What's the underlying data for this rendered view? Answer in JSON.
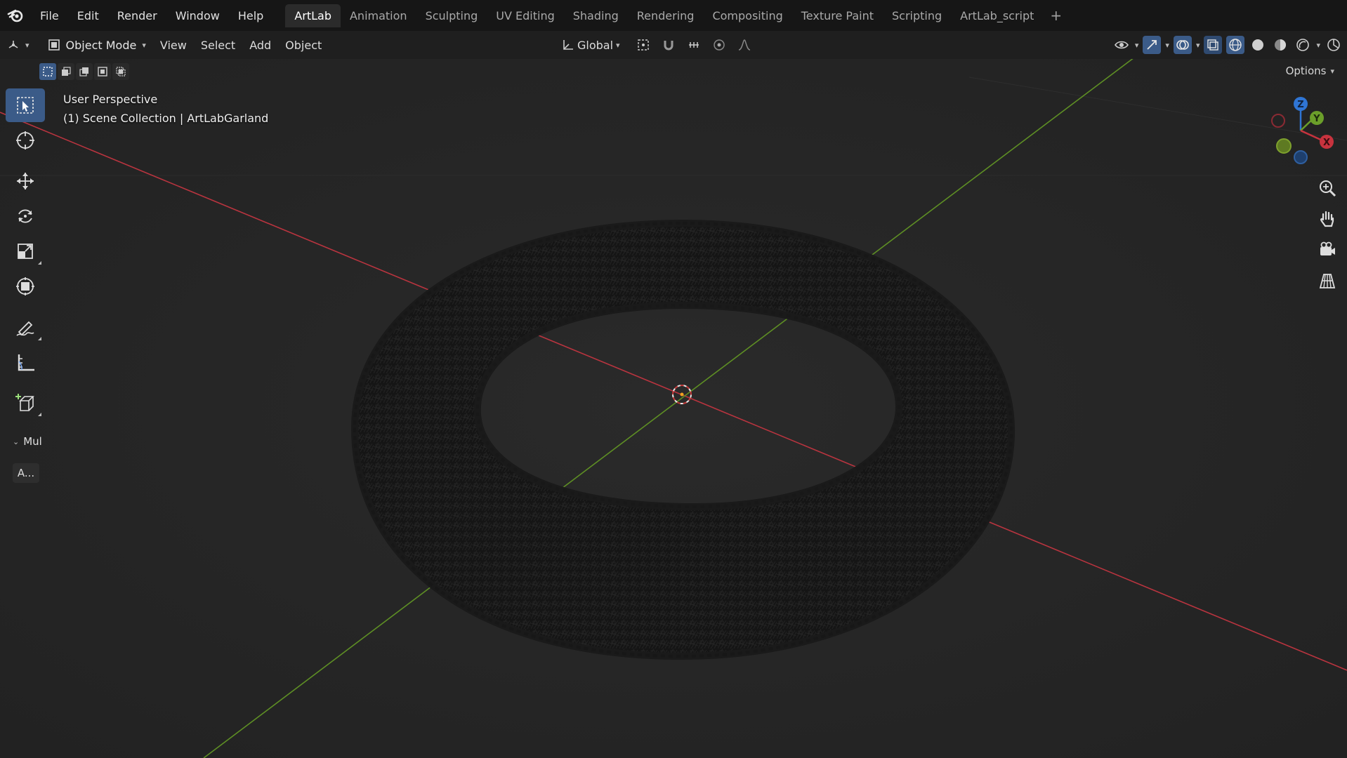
{
  "app": {
    "menus": [
      "File",
      "Edit",
      "Render",
      "Window",
      "Help"
    ],
    "workspaces": [
      "ArtLab",
      "Animation",
      "Sculpting",
      "UV Editing",
      "Shading",
      "Rendering",
      "Compositing",
      "Texture Paint",
      "Scripting",
      "ArtLab_script"
    ],
    "active_workspace": "ArtLab",
    "add_workspace": "+"
  },
  "header": {
    "mode": "Object Mode",
    "menus": [
      "View",
      "Select",
      "Add",
      "Object"
    ],
    "transform_orientation": "Global",
    "options_label": "Options"
  },
  "viewport": {
    "perspective_label": "User Perspective",
    "collection_label": "(1) Scene Collection | ArtLabGarland",
    "gizmo_axes": {
      "x": "X",
      "y": "Y",
      "z": "Z"
    },
    "axis_colors": {
      "x": "#c8333e",
      "y": "#6b9f2a",
      "z": "#2f75d4"
    }
  },
  "toolbar": {
    "tools": [
      "select-box-tool",
      "cursor-tool",
      "move-tool",
      "rotate-tool",
      "scale-tool",
      "transform-tool",
      "annotate-tool",
      "measure-tool",
      "add-cube-tool"
    ],
    "active_tool": "select-box-tool",
    "panel_label": "Mul",
    "panel_button": "A..."
  },
  "colors": {
    "accent": "#3b5b88",
    "topbar": "#161616",
    "viewport_bg": "#262626"
  }
}
